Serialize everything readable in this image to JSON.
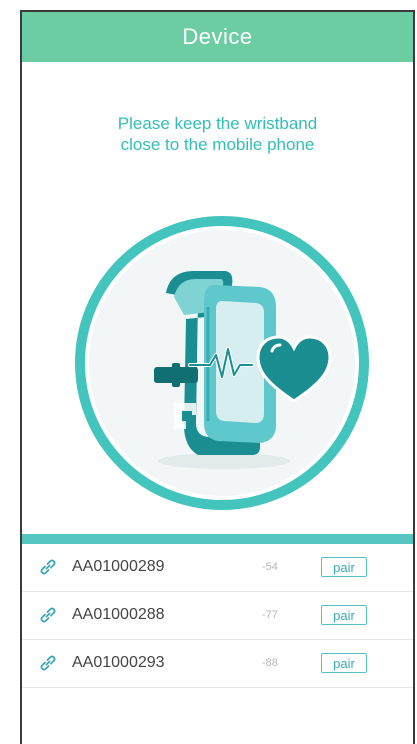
{
  "header": {
    "title": "Device"
  },
  "instruction": {
    "line1": "Please keep the wristband",
    "line2": "close to the mobile phone"
  },
  "devices": [
    {
      "name": "AA01000289",
      "rssi": "-54",
      "action_label": "pair",
      "icon": "link-icon"
    },
    {
      "name": "AA01000288",
      "rssi": "-77",
      "action_label": "pair",
      "icon": "link-icon"
    },
    {
      "name": "AA01000293",
      "rssi": "-88",
      "action_label": "pair",
      "icon": "link-icon"
    }
  ],
  "colors": {
    "header_bg": "#6ccda4",
    "accent": "#33bdb8",
    "divider": "#56c7c0",
    "circle_ring": "#43c4bd",
    "band_dark": "#1b8e91",
    "band_light": "#5fc8cc"
  }
}
